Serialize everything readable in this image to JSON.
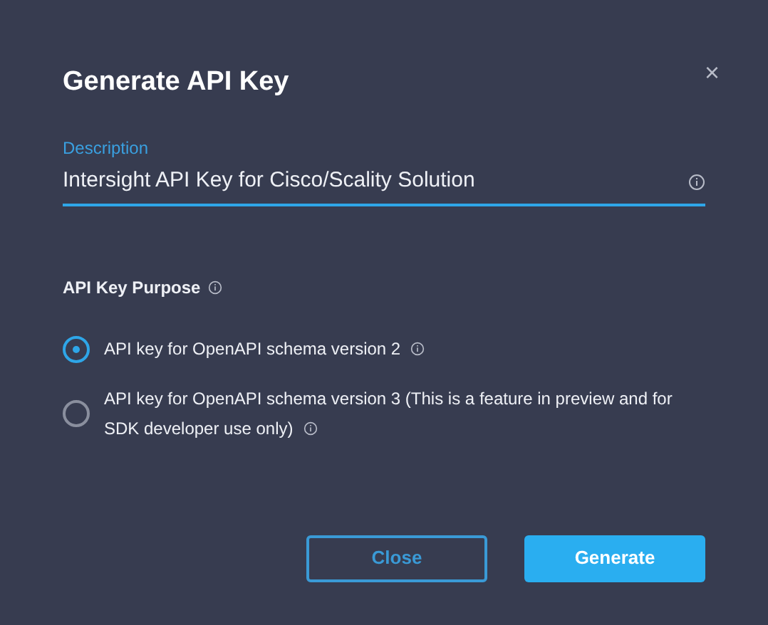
{
  "dialog": {
    "title": "Generate API Key",
    "close": "×"
  },
  "description": {
    "label": "Description",
    "value": "Intersight API Key for Cisco/Scality Solution"
  },
  "purpose": {
    "label": "API Key Purpose",
    "options": [
      {
        "label": "API key for OpenAPI schema version 2",
        "selected": true
      },
      {
        "label": "API key for OpenAPI schema version 3 (This is a feature in preview and for SDK developer use only)",
        "selected": false
      }
    ]
  },
  "buttons": [
    {
      "label": "Close",
      "kind": "secondary"
    },
    {
      "label": "Generate",
      "kind": "primary"
    }
  ]
}
